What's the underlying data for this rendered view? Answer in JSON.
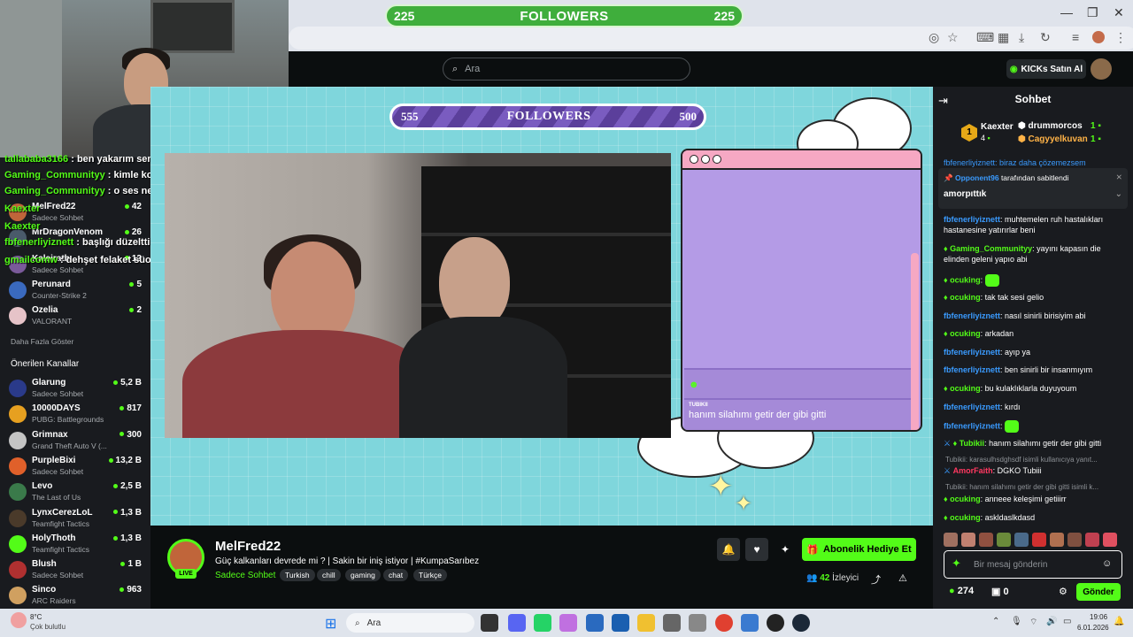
{
  "browser": {
    "icons": [
      "eye-off-icon",
      "star-icon",
      "translate-icon",
      "extensions-icon",
      "download-icon",
      "history-icon",
      "tab-list-icon",
      "profile-icon",
      "menu-icon"
    ],
    "window_controls": [
      "—",
      "❐",
      "✕"
    ]
  },
  "top_followers": {
    "left": "225",
    "label": "FOLLOWERS",
    "right": "225"
  },
  "header": {
    "search_placeholder": "Ara",
    "kicks_button": "KICKs Satın Al"
  },
  "overlay_chat": [
    {
      "user": "tallababa3166",
      "msg": "ben yakarım senin için"
    },
    {
      "user": "Gaming_Communityy",
      "msg": "kimle konuşuon yaw"
    },
    {
      "user": "Gaming_Communityy",
      "msg": "o ses nerden gelio"
    },
    {
      "user": "Kaexter",
      "msg": ""
    },
    {
      "user": "Kaexter",
      "msg": ""
    },
    {
      "user": "fbfenerliyiznett",
      "msg": "başlığı düzelttim"
    },
    {
      "user": "gmailcomw",
      "msg": "dehşet felaket süoper yayın"
    }
  ],
  "sidebar": {
    "followed": [
      {
        "name": "MelFred22",
        "game": "Sadece Sohbet",
        "count": "42",
        "color": "#c0653a"
      },
      {
        "name": "MrDragonVenom",
        "game": "",
        "count": "26",
        "color": "#4a5a6a"
      },
      {
        "name": "Kaleirath",
        "game": "Sadece Sohbet",
        "count": "12",
        "color": "#7a5a9a"
      },
      {
        "name": "Perunard",
        "game": "Counter-Strike 2",
        "count": "5",
        "color": "#3a6abf"
      },
      {
        "name": "Ozelia",
        "game": "VALORANT",
        "count": "2",
        "color": "#e6c3c8"
      }
    ],
    "show_more": "Daha Fazla Göster",
    "recommended_label": "Önerilen Kanallar",
    "recommended": [
      {
        "name": "Glarung",
        "game": "Sadece Sohbet",
        "count": "5,2 B",
        "color": "#2a3a8a"
      },
      {
        "name": "10000DAYS",
        "game": "PUBG: Battlegrounds",
        "count": "817",
        "color": "#e6a020"
      },
      {
        "name": "Grimnax",
        "game": "Grand Theft Auto V (...",
        "count": "300",
        "color": "#c4c4c4"
      },
      {
        "name": "PurpleBixi",
        "game": "Sadece Sohbet",
        "count": "13,2 B",
        "color": "#e0602a"
      },
      {
        "name": "Levo",
        "game": "The Last of Us",
        "count": "2,5 B",
        "color": "#3a7a4a"
      },
      {
        "name": "LynxCerezLoL",
        "game": "Teamfight Tactics",
        "count": "1,3 B",
        "color": "#4a3a2a"
      },
      {
        "name": "HolyThoth",
        "game": "Teamfight Tactics",
        "count": "1,3 B",
        "color": "#53fc18"
      },
      {
        "name": "Blush",
        "game": "Sadece Sohbet",
        "count": "1 B",
        "color": "#b03030"
      },
      {
        "name": "Sinco",
        "game": "ARC Raiders",
        "count": "963",
        "color": "#d0a060"
      }
    ]
  },
  "stream_overlay": {
    "followers_left": "555",
    "followers_label": "FOLLOWERS",
    "followers_right": "500",
    "chat_box_user": "TUBIKII",
    "chat_box_msg": "hanım silahımı getir der gibi gitti"
  },
  "stream_info": {
    "streamer": "MelFred22",
    "live": "LIVE",
    "title": "Güç kalkanları devrede mi ? | Sakin bir iniş istiyor | #KumpaSarıbez",
    "category": "Sadece Sohbet",
    "tags": [
      "Turkish",
      "chill",
      "gaming",
      "chat",
      "Türkçe"
    ],
    "gift_button": "Abonelik Hediye Et",
    "viewers_count": "42",
    "viewers_label": "İzleyici"
  },
  "chat": {
    "title": "Sohbet",
    "leaderboard": [
      {
        "name": "Kaexter",
        "value": "4"
      },
      {
        "name": "drummorcos",
        "value": "1"
      },
      {
        "name": "Cagyyelkuvan",
        "value": "1"
      }
    ],
    "pinned_by": "Opponent96",
    "pinned_suffix": "tarafından sabitlendi",
    "pinned_msg": "amorpıttık",
    "messages": [
      {
        "user": "fbfenerliyiznett",
        "cls": "cu-blue",
        "msg": "muhtemelen ruh hastalıkları hastanesine yatırırlar beni"
      },
      {
        "user": "Gaming_Communityy",
        "cls": "cu-green",
        "msg": "yayını kapasın die elinden geleni yapıo abi"
      },
      {
        "user": "ocuking",
        "cls": "cu-green",
        "msg": ""
      },
      {
        "user": "ocuking",
        "cls": "cu-green",
        "msg": "tak tak sesi gelio"
      },
      {
        "user": "fbfenerliyiznett",
        "cls": "cu-blue",
        "msg": "nasıl sinirli birisiyim abi"
      },
      {
        "user": "ocuking",
        "cls": "cu-green",
        "msg": "arkadan"
      },
      {
        "user": "fbfenerliyiznett",
        "cls": "cu-blue",
        "msg": "ayıp ya"
      },
      {
        "user": "fbfenerliyiznett",
        "cls": "cu-blue",
        "msg": "ben sinirli bir insanmıyım"
      },
      {
        "user": "ocuking",
        "cls": "cu-green",
        "msg": "bu kulaklıklarla duyuyoum"
      },
      {
        "user": "fbfenerliyiznett",
        "cls": "cu-blue",
        "msg": "kırdı"
      },
      {
        "user": "fbfenerliyiznett",
        "cls": "cu-blue",
        "msg": ""
      },
      {
        "user": "Tubikii",
        "cls": "cu-green",
        "msg": "hanım silahımı getir der gibi gitti"
      },
      {
        "user": "AmorFaith",
        "cls": "cu-red",
        "msg": "DGKO Tubiii"
      },
      {
        "user": "ocuking",
        "cls": "cu-green",
        "msg": "anneee keleşimi getiiirr"
      },
      {
        "user": "ocuking",
        "cls": "cu-green",
        "msg": "askldaslkdasd"
      }
    ],
    "partial_top": "fbfenerliyiznett: biraz daha çözemezsem",
    "reply1": "Tubikii: karasulhsdghsdf isimli kullanıcıya yanıt...",
    "reply2": "Tubikii: hanım silahımı getir der gibi gitti isimli k...",
    "input_placeholder": "Bir mesaj gönderin",
    "kicks_count": "274",
    "chest_count": "0",
    "send_button": "Gönder"
  },
  "taskbar": {
    "weather_temp": "8°C",
    "weather_desc": "Çok bulutlu",
    "search": "Ara",
    "time": "19:06",
    "date": "6.01.2026"
  }
}
